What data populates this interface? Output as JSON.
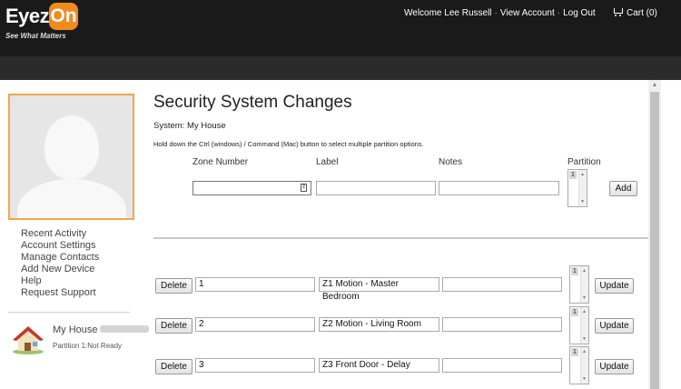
{
  "header": {
    "logo_main": "Eyez",
    "logo_on": "On",
    "logo_tagline": "See What Matters",
    "welcome": "Welcome Lee Russell",
    "view_account": "View Account",
    "log_out": "Log Out",
    "cart": "Cart (0)",
    "separator": "·"
  },
  "sidebar": {
    "menu": [
      "Recent Activity",
      "Account Settings",
      "Manage Contacts",
      "Add New Device",
      "Help",
      "Request Support"
    ],
    "house_name": "My House",
    "house_status": "Partition 1:Not Ready"
  },
  "main": {
    "title": "Security System Changes",
    "system_label": "System: My House",
    "hint": "Hold down the Ctrl (windows) / Command (Mac) button to select multiple partition options.",
    "columns": {
      "zone_number": "Zone Number",
      "label": "Label",
      "notes": "Notes",
      "partition": "Partition"
    },
    "new_zone": {
      "zone_number": "",
      "label": "",
      "notes": "",
      "partition_option": "1",
      "add_label": "Add"
    },
    "zones": [
      {
        "delete_label": "Delete",
        "zone_number": "1",
        "label": "Z1 Motion - Master Bedroom",
        "notes": "",
        "partition_option": "1",
        "update_label": "Update"
      },
      {
        "delete_label": "Delete",
        "zone_number": "2",
        "label": "Z2 Motion - Living Room",
        "notes": "",
        "partition_option": "1",
        "update_label": "Update"
      },
      {
        "delete_label": "Delete",
        "zone_number": "3",
        "label": "Z3 Front Door - Delay",
        "notes": "",
        "partition_option": "1",
        "update_label": "Update"
      }
    ]
  },
  "colors": {
    "header_bg": "#1a1a1a",
    "subbar_bg": "#2b2b2b",
    "logo_accent": "#f08a1c",
    "avatar_border": "#f0a64a"
  },
  "icons": {
    "cart": "cart-icon",
    "house": "house-icon",
    "avatar": "avatar-silhouette-icon",
    "number_spinner": "number-spinner-icon"
  }
}
